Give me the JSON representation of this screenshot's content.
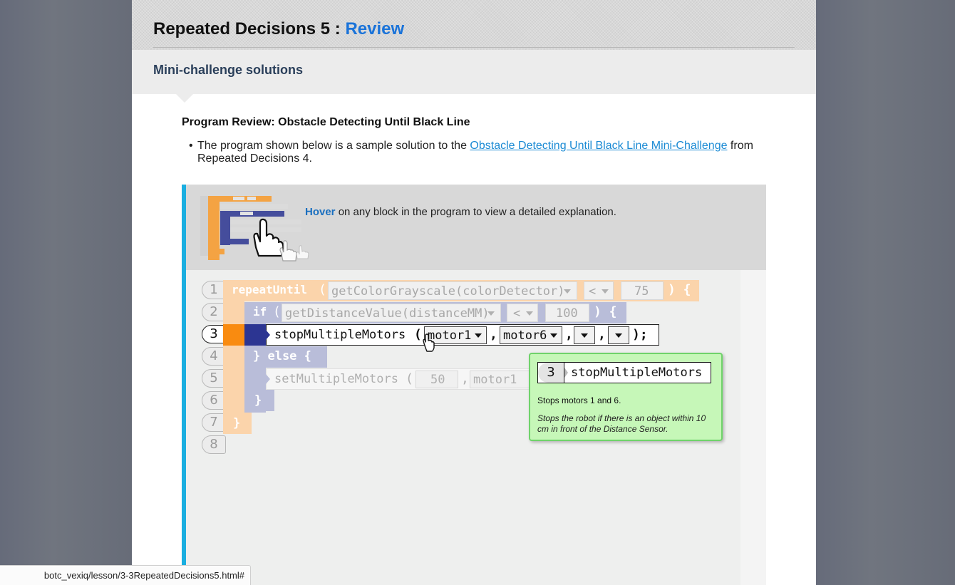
{
  "header": {
    "title": "Repeated Decisions 5",
    "sep": " : ",
    "review": "Review"
  },
  "subheader": {
    "title": "Mini-challenge solutions"
  },
  "section": {
    "title": "Program Review: Obstacle Detecting Until Black Line",
    "bullet_pre": "The program shown below is a sample solution to the ",
    "bullet_link": "Obstacle Detecting Until Black Line Mini-Challenge",
    "bullet_post": " from Repeated Decisions 4."
  },
  "panel": {
    "hover_word": "Hover",
    "hover_rest": " on any block in the program to view a detailed explanation."
  },
  "code": {
    "line_numbers": [
      "1",
      "2",
      "3",
      "4",
      "5",
      "6",
      "7",
      "8"
    ],
    "l1_keyword": "repeatUntil",
    "l1_call": "getColorGrayscale(colorDetector)",
    "l1_op": "<",
    "l1_value": "75",
    "l2_keyword": "if",
    "l2_call": "getDistanceValue(distanceMM)",
    "l2_op": "<",
    "l2_value": "100",
    "l3_func": "stopMultipleMotors",
    "l3_arg1": "motor1",
    "l3_arg2": "motor6",
    "l4_else": "} else {",
    "l5_func": "setMultipleMotors",
    "l5_value": "50",
    "l5_arg": "motor1",
    "l6_close": "}",
    "l7_close": "}"
  },
  "tooltip": {
    "line": "3",
    "name": "stopMultipleMotors",
    "desc": "Stops motors 1 and 6.",
    "note": "Stops the robot if there is an object within 10 cm in front of the Distance Sensor."
  },
  "status_url": "botc_vexiq/lesson/3-3RepeatedDecisions5.html#",
  "colors": {
    "accent_blue": "#1aaee0",
    "link": "#1a8ad4",
    "loop_orange": "#f99a2a",
    "if_blue": "#2c3592",
    "tooltip_bg": "#c6f7b8"
  },
  "icons": [
    "hand-pointer-icon",
    "program-thumbnail-icon",
    "dropdown-arrow-icon",
    "mouse-cursor-icon"
  ]
}
